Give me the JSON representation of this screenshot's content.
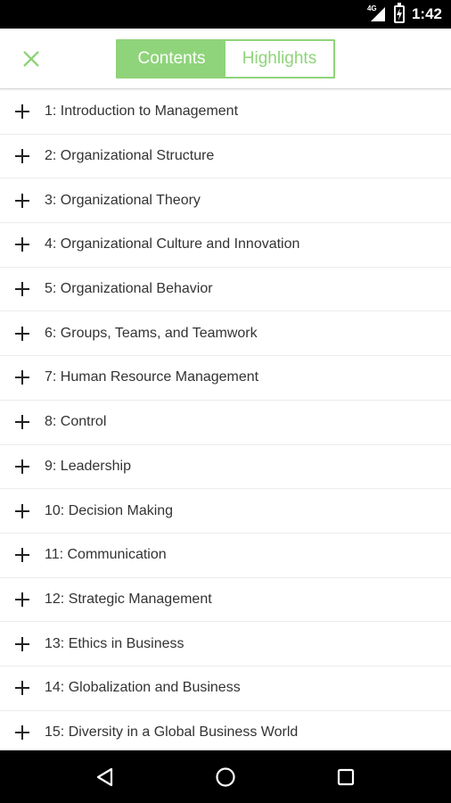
{
  "status_bar": {
    "network": "4G",
    "time": "1:42"
  },
  "toolbar": {
    "close_icon": "close-icon",
    "tabs": [
      {
        "label": "Contents",
        "active": true
      },
      {
        "label": "Highlights",
        "active": false
      }
    ]
  },
  "colors": {
    "accent": "#8fd47a",
    "text": "#333333",
    "divider": "#ececec"
  },
  "chapters": [
    {
      "label": "1: Introduction to Management"
    },
    {
      "label": "2: Organizational Structure"
    },
    {
      "label": "3: Organizational Theory"
    },
    {
      "label": "4: Organizational Culture and Innovation"
    },
    {
      "label": "5: Organizational Behavior"
    },
    {
      "label": "6: Groups, Teams, and Teamwork"
    },
    {
      "label": "7: Human Resource Management"
    },
    {
      "label": "8: Control"
    },
    {
      "label": "9: Leadership"
    },
    {
      "label": "10: Decision Making"
    },
    {
      "label": "11: Communication"
    },
    {
      "label": "12: Strategic Management"
    },
    {
      "label": "13: Ethics in Business"
    },
    {
      "label": "14: Globalization and Business"
    },
    {
      "label": "15: Diversity in a Global Business World"
    }
  ],
  "nav_bar": {
    "back_icon": "back-icon",
    "home_icon": "home-icon",
    "recents_icon": "recents-icon"
  }
}
